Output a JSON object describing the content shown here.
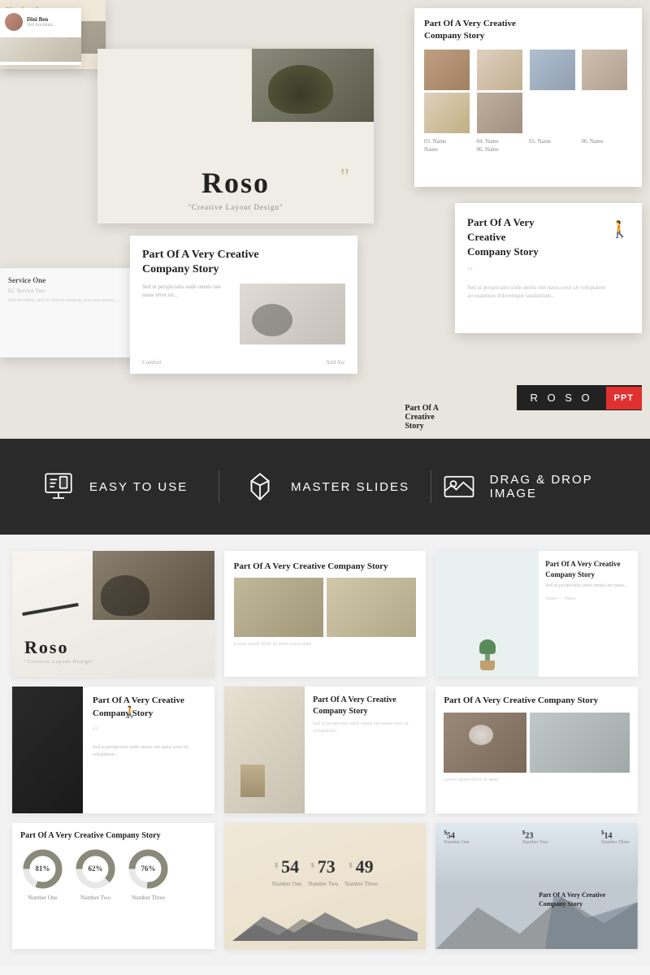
{
  "hero": {
    "main_slide": {
      "title": "Roso",
      "subtitle": "\"Creative Layout Design\"",
      "tagline": "Part Of A Very Creative Company Story"
    },
    "badge": {
      "text": "R O S O",
      "format": "PPT"
    }
  },
  "features": [
    {
      "id": "easy-to-use",
      "icon": "presentation-icon",
      "label": "EASY TO USE"
    },
    {
      "id": "master-slides",
      "icon": "gem-icon",
      "label": "MASTER SLIDES"
    },
    {
      "id": "drag-drop",
      "icon": "image-icon",
      "label": "DRAG & DROP IMAGE"
    }
  ],
  "slides_grid": [
    {
      "id": "gs1",
      "type": "title",
      "title": "Roso",
      "subtitle": "\"Creative Layout Design\""
    },
    {
      "id": "gs2",
      "type": "story-building",
      "title": "Part Of A Very Creative Company Story"
    },
    {
      "id": "gs3",
      "type": "story-plant",
      "title": "Part Of A Very Creative Company Story"
    },
    {
      "id": "gs4",
      "type": "story-dark",
      "title": "Part Of A Very Creative Company Story"
    },
    {
      "id": "gs5",
      "type": "story-interior",
      "title": "Part Of A Very Creative Company Story"
    },
    {
      "id": "gs6",
      "type": "story-coffee",
      "title": "Part Of A Very Creative Company Story"
    },
    {
      "id": "gs7",
      "type": "charts",
      "title": "Part Of A Very Creative Company Story",
      "values": [
        81,
        62,
        76
      ],
      "labels": [
        "Number One",
        "Number Two",
        "Number Three"
      ]
    },
    {
      "id": "gs8",
      "type": "pricing",
      "prices": [
        {
          "sign": "$",
          "value": "54",
          "label": "Number One"
        },
        {
          "sign": "$",
          "value": "73",
          "label": "Number Two"
        },
        {
          "sign": "$",
          "value": "49",
          "label": "Number Three"
        }
      ]
    },
    {
      "id": "gs9",
      "type": "pricing-landscape",
      "prices": [
        {
          "sign": "$",
          "value": "54",
          "label": "Number One"
        },
        {
          "sign": "$",
          "value": "23",
          "label": "Number Two"
        },
        {
          "sign": "$",
          "value": "14",
          "label": "Number Three"
        }
      ],
      "title": "Part Of A Very Creative Company Story"
    }
  ]
}
